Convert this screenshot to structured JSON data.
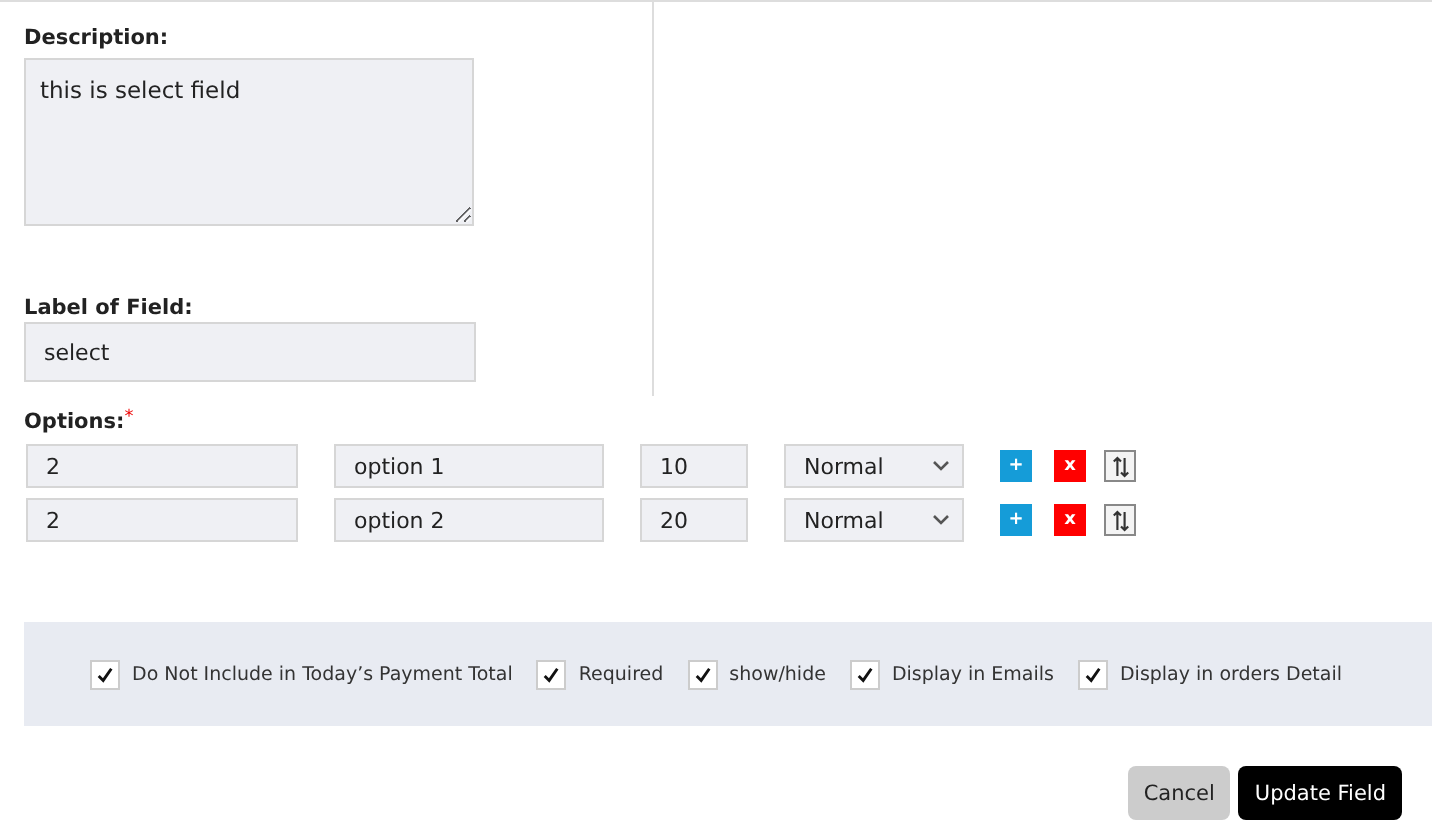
{
  "description": {
    "label": "Description:",
    "value": "this is select field"
  },
  "field_label": {
    "label": "Label of Field:",
    "value": "select"
  },
  "options": {
    "label": "Options:",
    "required_mark": "*",
    "rows": [
      {
        "col_1": "2",
        "name": "option 1",
        "col_3": "10",
        "type": "Normal",
        "add_label": "+",
        "remove_label": "x"
      },
      {
        "col_1": "2",
        "name": "option 2",
        "col_3": "20",
        "type": "Normal",
        "add_label": "+",
        "remove_label": "x"
      }
    ]
  },
  "checkboxes": [
    {
      "label": "Do Not Include in Today’s Payment Total",
      "checked": true
    },
    {
      "label": "Required",
      "checked": true
    },
    {
      "label": "show/hide",
      "checked": true
    },
    {
      "label": "Display in Emails",
      "checked": true
    },
    {
      "label": "Display in orders Detail",
      "checked": true
    }
  ],
  "buttons": [
    {
      "label": "Cancel",
      "kind": "secondary"
    },
    {
      "label": "Update Field",
      "kind": "primary"
    }
  ]
}
